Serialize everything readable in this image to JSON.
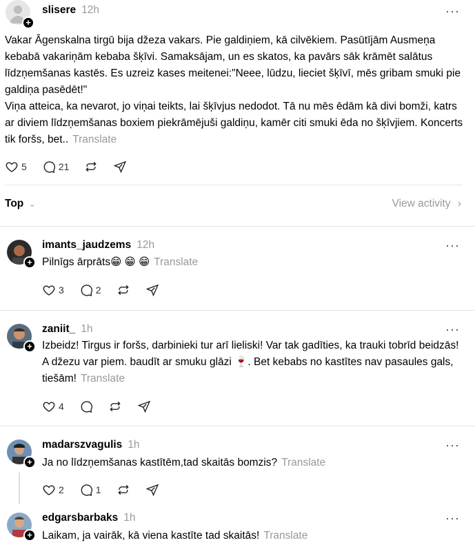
{
  "main_post": {
    "username": "slisere",
    "time": "12h",
    "more": "···",
    "text_p1": "Vakar Āgenskalna tirgū bija džeza vakars. Pie galdiņiem, kā cilvēkiem. Pasūtījām Ausmeņa kebabā vakariņām kebaba šķīvi. Samaksājam, un es skatos, ka pavārs sāk krāmēt salātus līdzņemšanas kastēs. Es uzreiz kases meitenei:\"Neee, lūdzu, lieciet šķīvī, mēs gribam smuki pie galdiņa pasēdēt!\"",
    "text_p2": "Viņa atteica, ka nevarot, jo viņai teikts, lai šķīvjus nedodot. Tā nu mēs ēdām kā divi bomži, katrs ar diviem līdzņemšanas boxiem piekrāmējuši galdiņu, kamēr citi smuki ēda no šķīvjiem. Koncerts tik foršs, bet..",
    "translate": "Translate",
    "likes": "5",
    "comments": "21"
  },
  "sort_bar": {
    "label": "Top",
    "view_activity": "View activity"
  },
  "replies": [
    {
      "username": "imants_jaudzems",
      "time": "12h",
      "text": "Pilnīgs ārprāts😁 😁 😁",
      "translate": "Translate",
      "likes": "3",
      "comments": "2"
    },
    {
      "username": "zaniit_",
      "time": "1h",
      "text": "Izbeidz! Tirgus ir foršs, darbinieki tur arī lieliski! Var tak gadīties, ka trauki tobrīd beidzās! A džezu var piem. baudīt ar smuku glāzi 🍷. Bet kebabs no kastītes nav pasaules gals, tiešām!",
      "translate": "Translate",
      "likes": "4",
      "comments": ""
    },
    {
      "username": "madarszvagulis",
      "time": "1h",
      "text": "Ja no līdzņemšanas kastītēm,tad skaitās bomzis?",
      "translate": "Translate",
      "likes": "2",
      "comments": "1"
    },
    {
      "username": "edgarsbarbaks",
      "time": "1h",
      "text": "Laikam, ja vairāk, kā viena kastīte tad skaitās!",
      "translate": "Translate"
    }
  ],
  "icons": {
    "like": "heart-icon",
    "comment": "comment-icon",
    "repost": "repost-icon",
    "share": "share-icon",
    "follow": "plus-icon",
    "more": "more-icon"
  }
}
